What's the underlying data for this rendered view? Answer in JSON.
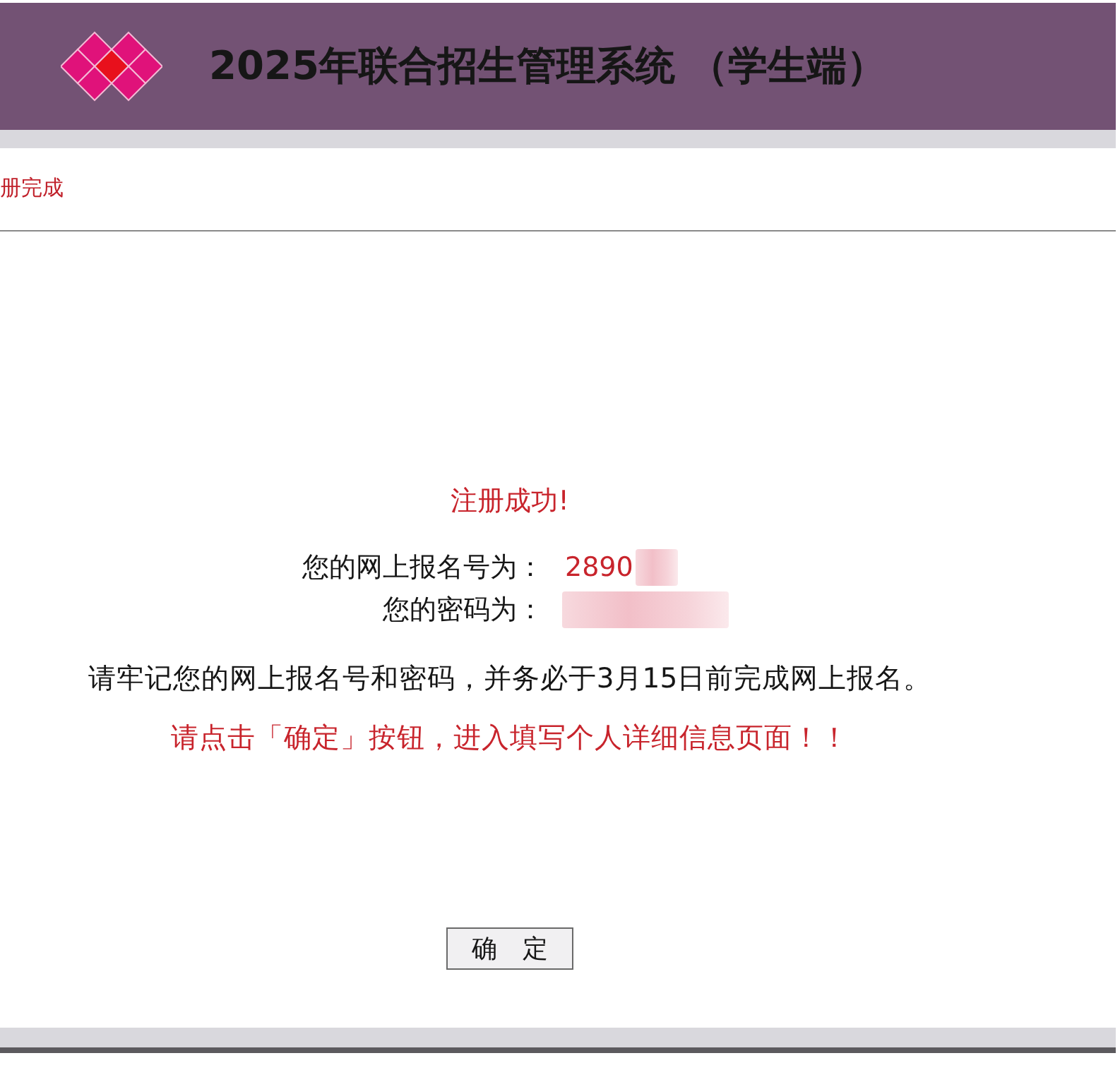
{
  "header": {
    "title": "2025年联合招生管理系统 （学生端）"
  },
  "breadcrumb": {
    "text": "册完成"
  },
  "result": {
    "heading": "注册成功!",
    "fields": [
      {
        "label": "您的网上报名号为：",
        "value": "2890",
        "redacted": true
      },
      {
        "label": "您的密码为：",
        "redacted": true
      }
    ],
    "notice": "请牢记您的网上报名号和密码，并务必于3月15日前完成网上报名。",
    "instruction": "请点击「确定」按钮，进入填写个人详细信息页面！！"
  },
  "buttons": [
    {
      "label": "确　定"
    }
  ]
}
